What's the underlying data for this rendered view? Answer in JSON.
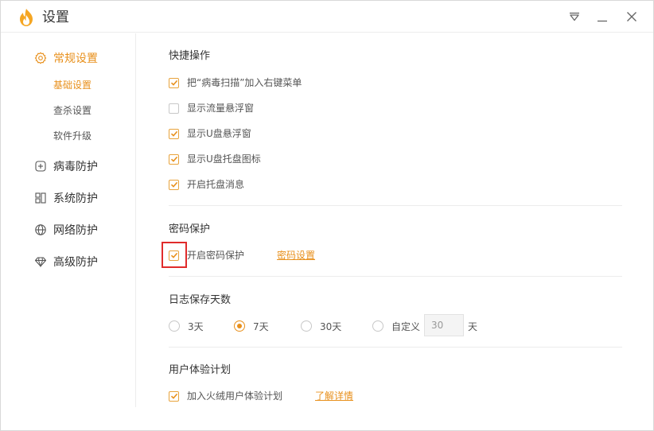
{
  "window": {
    "title": "设置"
  },
  "sidebar": {
    "groups": [
      {
        "label": "常规设置",
        "icon": "gear-icon",
        "active": true,
        "items": [
          {
            "label": "基础设置",
            "active": true
          },
          {
            "label": "查杀设置"
          },
          {
            "label": "软件升级"
          }
        ]
      },
      {
        "label": "病毒防护",
        "icon": "plus-square-icon"
      },
      {
        "label": "系统防护",
        "icon": "grid-icon"
      },
      {
        "label": "网络防护",
        "icon": "globe-icon"
      },
      {
        "label": "高级防护",
        "icon": "diamond-icon"
      }
    ]
  },
  "sections": {
    "quick": {
      "title": "快捷操作",
      "options": [
        {
          "label": "把“病毒扫描”加入右键菜单",
          "checked": true
        },
        {
          "label": "显示流量悬浮窗",
          "checked": false
        },
        {
          "label": "显示U盘悬浮窗",
          "checked": true
        },
        {
          "label": "显示U盘托盘图标",
          "checked": true
        },
        {
          "label": "开启托盘消息",
          "checked": true
        }
      ]
    },
    "password": {
      "title": "密码保护",
      "option": {
        "label": "开启密码保护",
        "checked": true
      },
      "link": "密码设置"
    },
    "log": {
      "title": "日志保存天数",
      "options": [
        {
          "label": "3天",
          "checked": false
        },
        {
          "label": "7天",
          "checked": true
        },
        {
          "label": "30天",
          "checked": false
        },
        {
          "label": "自定义",
          "checked": false
        }
      ],
      "custom_value": "30",
      "unit": "天"
    },
    "experience": {
      "title": "用户体验计划",
      "option": {
        "label": "加入火绒用户体验计划",
        "checked": true
      },
      "link": "了解详情"
    }
  },
  "colors": {
    "accent": "#e8901c",
    "highlight": "#e02b2b"
  }
}
